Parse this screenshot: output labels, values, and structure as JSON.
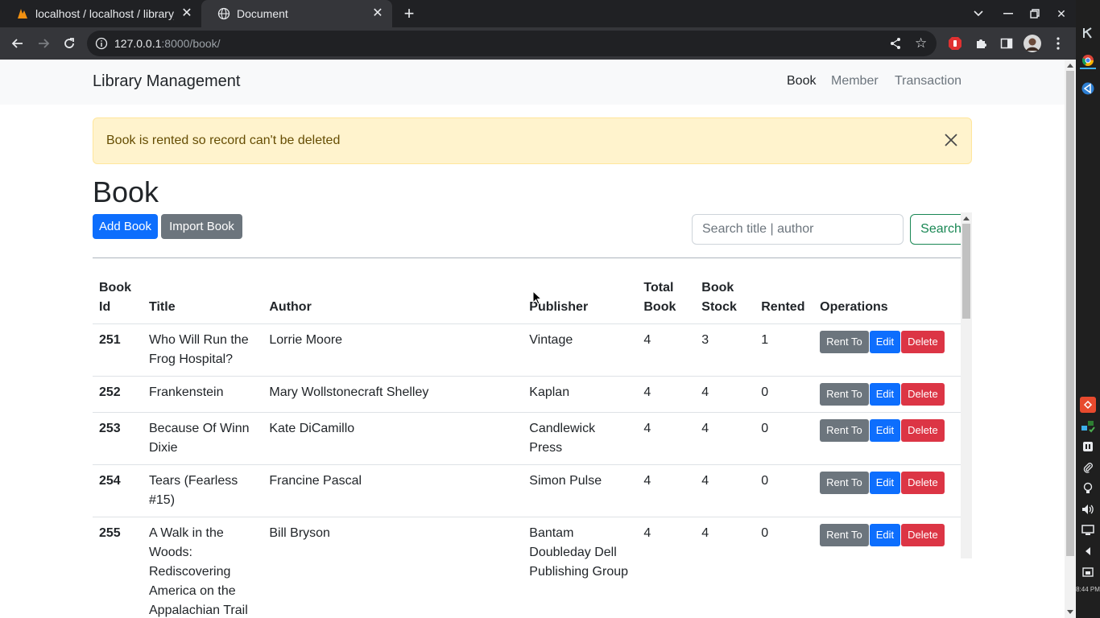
{
  "browser": {
    "tabs": [
      {
        "title": "localhost / localhost / library_"
      },
      {
        "title": "Document"
      }
    ],
    "url": {
      "host": "127.0.0.1",
      "rest": ":8000/book/"
    }
  },
  "navbar": {
    "brand": "Library Management",
    "links": [
      {
        "label": "Book"
      },
      {
        "label": "Member"
      },
      {
        "label": "Transaction"
      }
    ]
  },
  "alert": {
    "message": "Book is rented so record can't be deleted"
  },
  "page": {
    "title": "Book",
    "add_label": "Add Book",
    "import_label": "Import Book",
    "search_placeholder": "Search title | author",
    "search_label": "Search"
  },
  "table": {
    "headers": [
      "Book Id",
      "Title",
      "Author",
      "Publisher",
      "Total Book",
      "Book Stock",
      "Rented",
      "Operations"
    ],
    "ops_labels": {
      "rent": "Rent To",
      "edit": "Edit",
      "delete": "Delete"
    },
    "rows": [
      {
        "id": "251",
        "title": "Who Will Run the Frog Hospital?",
        "author": "Lorrie Moore",
        "publisher": "Vintage",
        "total": "4",
        "stock": "3",
        "rented": "1"
      },
      {
        "id": "252",
        "title": "Frankenstein",
        "author": "Mary Wollstonecraft Shelley",
        "publisher": "Kaplan",
        "total": "4",
        "stock": "4",
        "rented": "0"
      },
      {
        "id": "253",
        "title": "Because Of Winn Dixie",
        "author": "Kate DiCamillo",
        "publisher": "Candlewick Press",
        "total": "4",
        "stock": "4",
        "rented": "0"
      },
      {
        "id": "254",
        "title": "Tears (Fearless #15)",
        "author": "Francine Pascal",
        "publisher": "Simon Pulse",
        "total": "4",
        "stock": "4",
        "rented": "0"
      },
      {
        "id": "255",
        "title": "A Walk in the Woods: Rediscovering America on the Appalachian Trail",
        "author": "Bill Bryson",
        "publisher": "Bantam Doubleday Dell Publishing Group",
        "total": "4",
        "stock": "4",
        "rented": "0"
      }
    ]
  },
  "system": {
    "clock": "8:44 PM"
  }
}
